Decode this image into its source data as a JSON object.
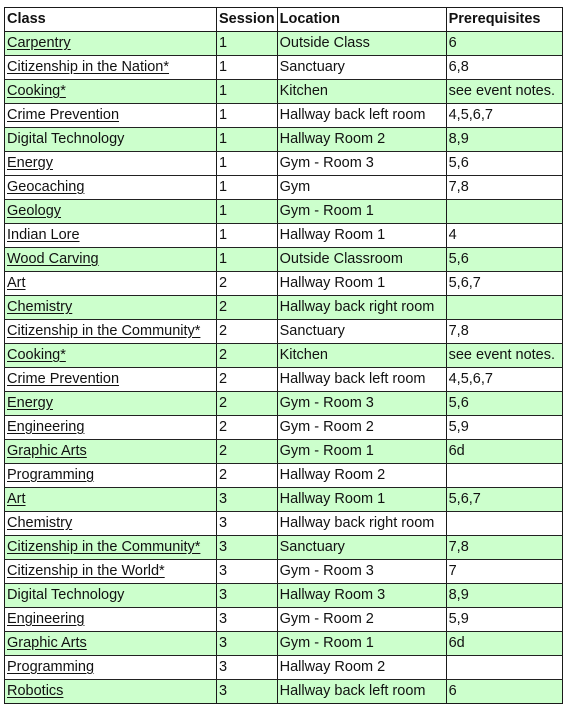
{
  "headers": {
    "class": "Class",
    "session": "Session",
    "location": "Location",
    "prerequisites": "Prerequisites"
  },
  "row_highlight_color": "#ccffcc",
  "rows": [
    {
      "class": "Carpentry",
      "session": "1",
      "location": "Outside Class",
      "prerequisites": "6",
      "highlight": true,
      "link": true
    },
    {
      "class": "Citizenship in the Nation*",
      "session": "1",
      "location": "Sanctuary",
      "prerequisites": "6,8",
      "highlight": false,
      "link": true
    },
    {
      "class": "Cooking*",
      "session": "1",
      "location": "Kitchen",
      "prerequisites": "see event notes.",
      "highlight": true,
      "link": true
    },
    {
      "class": "Crime Prevention",
      "session": "1",
      "location": "Hallway back left room",
      "prerequisites": "4,5,6,7",
      "highlight": false,
      "link": true
    },
    {
      "class": "Digital Technology",
      "session": "1",
      "location": "Hallway Room 2",
      "prerequisites": "8,9",
      "highlight": true,
      "link": false
    },
    {
      "class": "Energy",
      "session": "1",
      "location": "Gym - Room 3",
      "prerequisites": "5,6",
      "highlight": false,
      "link": true
    },
    {
      "class": "Geocaching",
      "session": "1",
      "location": "Gym",
      "prerequisites": "7,8",
      "highlight": false,
      "link": true
    },
    {
      "class": "Geology",
      "session": "1",
      "location": "Gym - Room 1",
      "prerequisites": "",
      "highlight": true,
      "link": true
    },
    {
      "class": "Indian Lore",
      "session": "1",
      "location": "Hallway Room 1",
      "prerequisites": "4",
      "highlight": false,
      "link": true
    },
    {
      "class": "Wood Carving",
      "session": "1",
      "location": "Outside Classroom",
      "prerequisites": "5,6",
      "highlight": true,
      "link": true
    },
    {
      "class": "Art",
      "session": "2",
      "location": "Hallway Room 1",
      "prerequisites": "5,6,7",
      "highlight": false,
      "link": true
    },
    {
      "class": "Chemistry",
      "session": "2",
      "location": "Hallway back right room",
      "prerequisites": "",
      "highlight": true,
      "link": true
    },
    {
      "class": "Citizenship in the Community*",
      "session": "2",
      "location": "Sanctuary",
      "prerequisites": "7,8",
      "highlight": false,
      "link": true
    },
    {
      "class": "Cooking*",
      "session": "2",
      "location": "Kitchen",
      "prerequisites": "see event notes.",
      "highlight": true,
      "link": true
    },
    {
      "class": "Crime Prevention",
      "session": "2",
      "location": "Hallway back left room",
      "prerequisites": "4,5,6,7",
      "highlight": false,
      "link": true
    },
    {
      "class": "Energy",
      "session": "2",
      "location": "Gym - Room 3",
      "prerequisites": "5,6",
      "highlight": true,
      "link": true
    },
    {
      "class": "Engineering",
      "session": "2",
      "location": "Gym - Room 2",
      "prerequisites": "5,9",
      "highlight": false,
      "link": true
    },
    {
      "class": "Graphic Arts",
      "session": "2",
      "location": "Gym - Room 1",
      "prerequisites": "6d",
      "highlight": true,
      "link": true
    },
    {
      "class": "Programming",
      "session": "2",
      "location": "Hallway Room 2",
      "prerequisites": "",
      "highlight": false,
      "link": true
    },
    {
      "class": "Art",
      "session": "3",
      "location": "Hallway Room 1",
      "prerequisites": "5,6,7",
      "highlight": true,
      "link": true
    },
    {
      "class": "Chemistry",
      "session": "3",
      "location": "Hallway back right room",
      "prerequisites": "",
      "highlight": false,
      "link": true
    },
    {
      "class": "Citizenship in the Community*",
      "session": "3",
      "location": "Sanctuary",
      "prerequisites": "7,8",
      "highlight": true,
      "link": true
    },
    {
      "class": "Citizenship in the World*",
      "session": "3",
      "location": "Gym - Room 3",
      "prerequisites": "7",
      "highlight": false,
      "link": true
    },
    {
      "class": "Digital Technology",
      "session": "3",
      "location": "Hallway Room 3",
      "prerequisites": "8,9",
      "highlight": true,
      "link": false
    },
    {
      "class": "Engineering",
      "session": "3",
      "location": "Gym - Room 2",
      "prerequisites": "5,9",
      "highlight": false,
      "link": true
    },
    {
      "class": "Graphic Arts",
      "session": "3",
      "location": "Gym - Room 1",
      "prerequisites": "6d",
      "highlight": true,
      "link": true
    },
    {
      "class": "Programming",
      "session": "3",
      "location": "Hallway Room 2",
      "prerequisites": "",
      "highlight": false,
      "link": true
    },
    {
      "class": "Robotics",
      "session": "3",
      "location": "Hallway back left room",
      "prerequisites": "6",
      "highlight": true,
      "link": true
    }
  ]
}
